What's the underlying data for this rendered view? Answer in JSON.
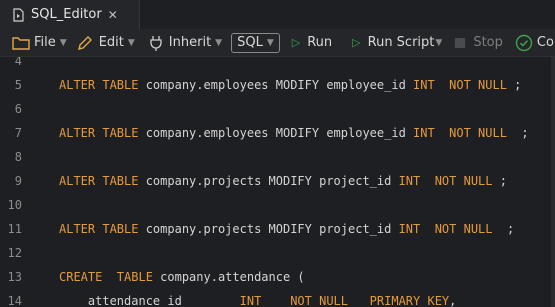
{
  "tab": {
    "title": "SQL_Editor",
    "close": "✕"
  },
  "toolbar": {
    "file": "File",
    "edit": "Edit",
    "inherit": "Inherit",
    "language": "SQL",
    "run": "Run",
    "run_script": "Run Script",
    "stop": "Stop",
    "commit": "Com"
  },
  "editor": {
    "lines": [
      {
        "num": "4"
      },
      {
        "num": "5",
        "kw1": "ALTER TABLE",
        "mid": " company.employees MODIFY employee_id ",
        "kw2": "INT  NOT NULL",
        "end": " ;"
      },
      {
        "num": "6"
      },
      {
        "num": "7",
        "kw1": "ALTER TABLE",
        "mid": " company.employees MODIFY employee_id ",
        "kw2": "INT  NOT NULL",
        "end": "  ;"
      },
      {
        "num": "8"
      },
      {
        "num": "9",
        "kw1": "ALTER TABLE",
        "mid": " company.projects MODIFY project_id ",
        "kw2": "INT  NOT NULL",
        "end": " ;"
      },
      {
        "num": "10"
      },
      {
        "num": "11",
        "kw1": "ALTER TABLE",
        "mid": " company.projects MODIFY project_id ",
        "kw2": "INT  NOT NULL",
        "end": "  ;"
      },
      {
        "num": "12"
      },
      {
        "num": "13",
        "kw1": "CREATE  TABLE",
        "mid": " company.attendance (",
        "kw2": "",
        "end": ""
      },
      {
        "num": "14",
        "pre": "    attendance_id        ",
        "kw1": "INT    NOT NULL   PRIMARY KEY",
        "mid": ",",
        "kw2": "",
        "end": ""
      }
    ]
  },
  "colors": {
    "keyword": "#e59a3c",
    "text": "#d4d4d4",
    "line_number": "#8c8c8c",
    "background": "#1e1f22",
    "run_green": "#3fa34d"
  }
}
